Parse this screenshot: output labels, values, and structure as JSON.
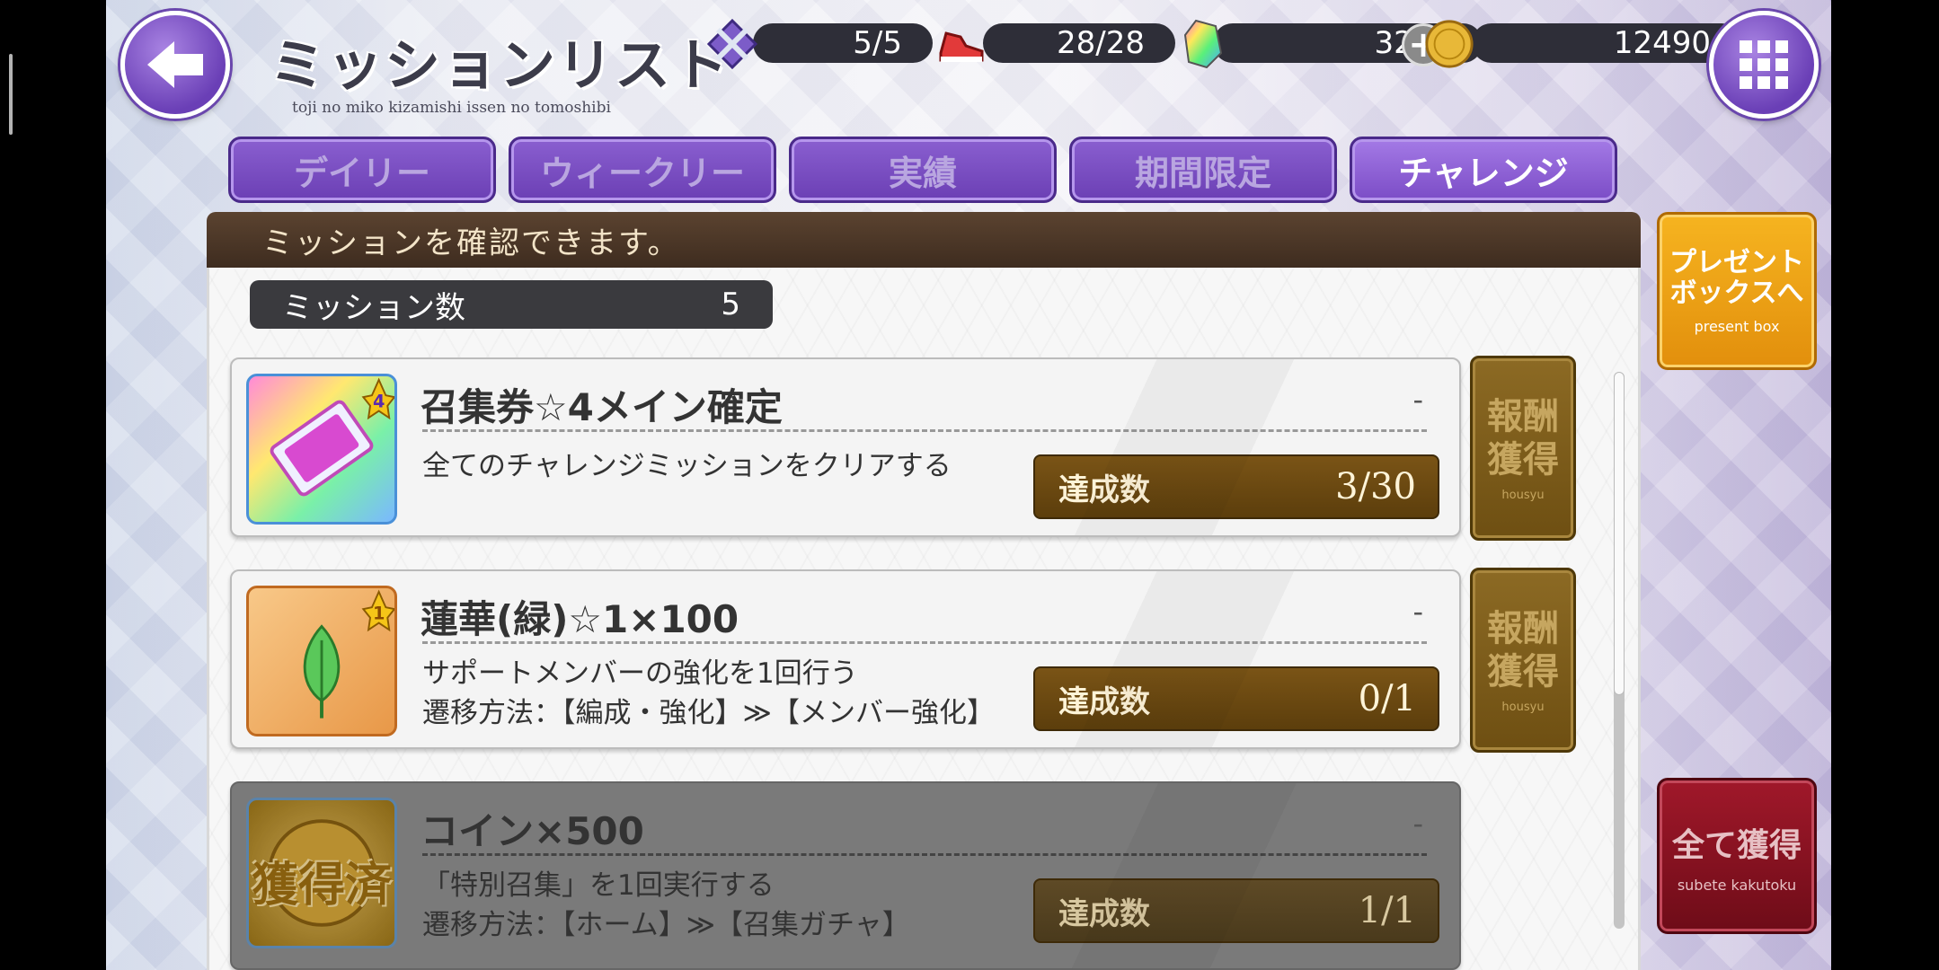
{
  "header": {
    "title": "ミッションリスト",
    "subtitle": "toji no miko kizamishi issen no tomoshibi"
  },
  "resources": {
    "battle": "5/5",
    "stamina": "28/28",
    "crystals": "3240",
    "coins": "12490"
  },
  "tabs": [
    {
      "label": "デイリー",
      "active": false
    },
    {
      "label": "ウィークリー",
      "active": false
    },
    {
      "label": "実績",
      "active": false
    },
    {
      "label": "期間限定",
      "active": false
    },
    {
      "label": "チャレンジ",
      "active": true
    }
  ],
  "panel": {
    "header": "ミッションを確認できます。",
    "count_label": "ミッション数",
    "count_value": "5"
  },
  "missions": [
    {
      "reward": "召集券☆4メイン確定",
      "rarity": "4",
      "hyphen": "-",
      "desc1": "全てのチャレンジミッションをクリアする",
      "desc2": "",
      "progress_label": "達成数",
      "progress": "3/30",
      "claim_jp1": "報酬",
      "claim_jp2": "獲得",
      "claim_en": "housyu"
    },
    {
      "reward": "蓮華(緑)☆1×100",
      "rarity": "1",
      "hyphen": "-",
      "desc1": "サポートメンバーの強化を1回行う",
      "desc2": "遷移方法：【編成・強化】≫【メンバー強化】",
      "progress_label": "達成数",
      "progress": "0/1",
      "claim_jp1": "報酬",
      "claim_jp2": "獲得",
      "claim_en": "housyu"
    },
    {
      "reward": "コイン×500",
      "hyphen": "-",
      "stamp": "獲得済",
      "desc1": "「特別召集」を1回実行する",
      "desc2": "遷移方法：【ホーム】≫【召集ガチャ】",
      "progress_label": "達成数",
      "progress": "1/1"
    }
  ],
  "side": {
    "present_jp1": "プレゼント",
    "present_jp2": "ボックスへ",
    "present_en": "present box",
    "getall_jp": "全て獲得",
    "getall_en": "subete kakutoku"
  },
  "colors": {
    "accent_purple": "#7b4cc6",
    "panel_header_brown": "#4a3524",
    "progress_gold": "#6b4a12",
    "present_orange": "#f0a018",
    "getall_red": "#8a1222"
  }
}
